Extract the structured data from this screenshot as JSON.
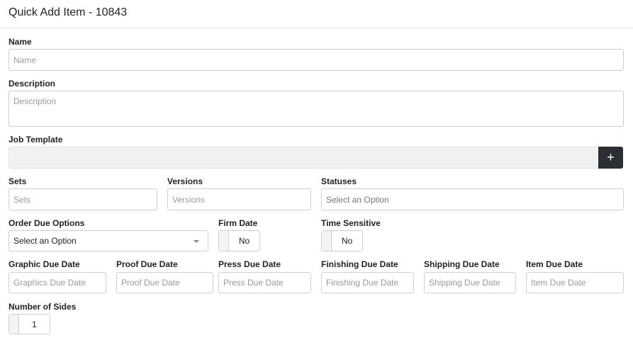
{
  "header": {
    "title": "Quick Add Item - 10843"
  },
  "fields": {
    "name": {
      "label": "Name",
      "placeholder": "Name"
    },
    "description": {
      "label": "Description",
      "placeholder": "Description"
    },
    "job_template": {
      "label": "Job Template",
      "add_icon": "plus-icon",
      "add_label": "+"
    },
    "sets": {
      "label": "Sets",
      "placeholder": "Sets"
    },
    "versions": {
      "label": "Versions",
      "placeholder": "Versions"
    },
    "statuses": {
      "label": "Statuses",
      "placeholder": "Select an Option"
    },
    "order_due_options": {
      "label": "Order Due Options",
      "value": "Select an Option"
    },
    "firm_date": {
      "label": "Firm Date",
      "value": "No"
    },
    "time_sensitive": {
      "label": "Time Sensitive",
      "value": "No"
    },
    "graphic_due_date": {
      "label": "Graphic Due Date",
      "placeholder": "Graphics Due Date"
    },
    "proof_due_date": {
      "label": "Proof Due Date",
      "placeholder": "Proof Due Date"
    },
    "press_due_date": {
      "label": "Press Due Date",
      "placeholder": "Press Due Date"
    },
    "finishing_due_date": {
      "label": "Finishing Due Date",
      "placeholder": "Finishing Due Date"
    },
    "shipping_due_date": {
      "label": "Shipping Due Date",
      "placeholder": "Shipping Due Date"
    },
    "item_due_date": {
      "label": "Item Due Date",
      "placeholder": "Item Due Date"
    },
    "number_of_sides": {
      "label": "Number of Sides",
      "value": "1"
    }
  }
}
